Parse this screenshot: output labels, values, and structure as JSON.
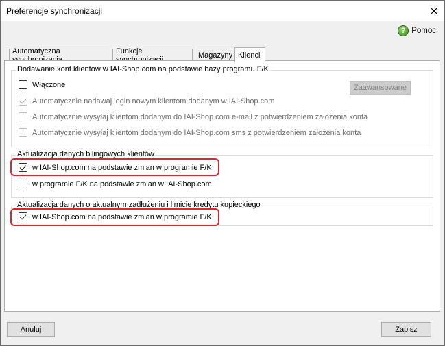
{
  "window": {
    "title": "Preferencje synchronizacji"
  },
  "help": {
    "label": "Pomoc"
  },
  "tabs": [
    {
      "label": "Automatyczna synchronizacja"
    },
    {
      "label": "Funkcje synchronizacji"
    },
    {
      "label": "Magazyny"
    },
    {
      "label": "Klienci"
    }
  ],
  "active_tab": "Klienci",
  "group1": {
    "title": "Dodawanie kont klientów w IAI-Shop.com na podstawie bazy programu F/K",
    "enabled_label": "Włączone",
    "advanced_button": "Zaawansowane",
    "options": [
      "Automatycznie nadawaj login nowym klientom dodanym w IAI-Shop.com",
      "Automatycznie wysyłaj klientom dodanym do IAI-Shop.com e-mail z potwierdzeniem założenia konta",
      "Automatycznie wysyłaj klientom dodanym do IAI-Shop.com sms z potwierdzeniem założenia konta"
    ]
  },
  "group2": {
    "title": "Aktualizacja danych bilingowych klientów",
    "options": [
      "w IAI-Shop.com na podstawie zmian w programie F/K",
      "w programie F/K na podstawie zmian w IAI-Shop.com"
    ]
  },
  "group3": {
    "title": "Aktualizacja danych o aktualnym zadłużeniu i limicie kredytu kupieckiego",
    "options": [
      "w IAI-Shop.com na podstawie zmian w programie F/K"
    ]
  },
  "footer": {
    "cancel": "Anuluj",
    "save": "Zapisz"
  }
}
